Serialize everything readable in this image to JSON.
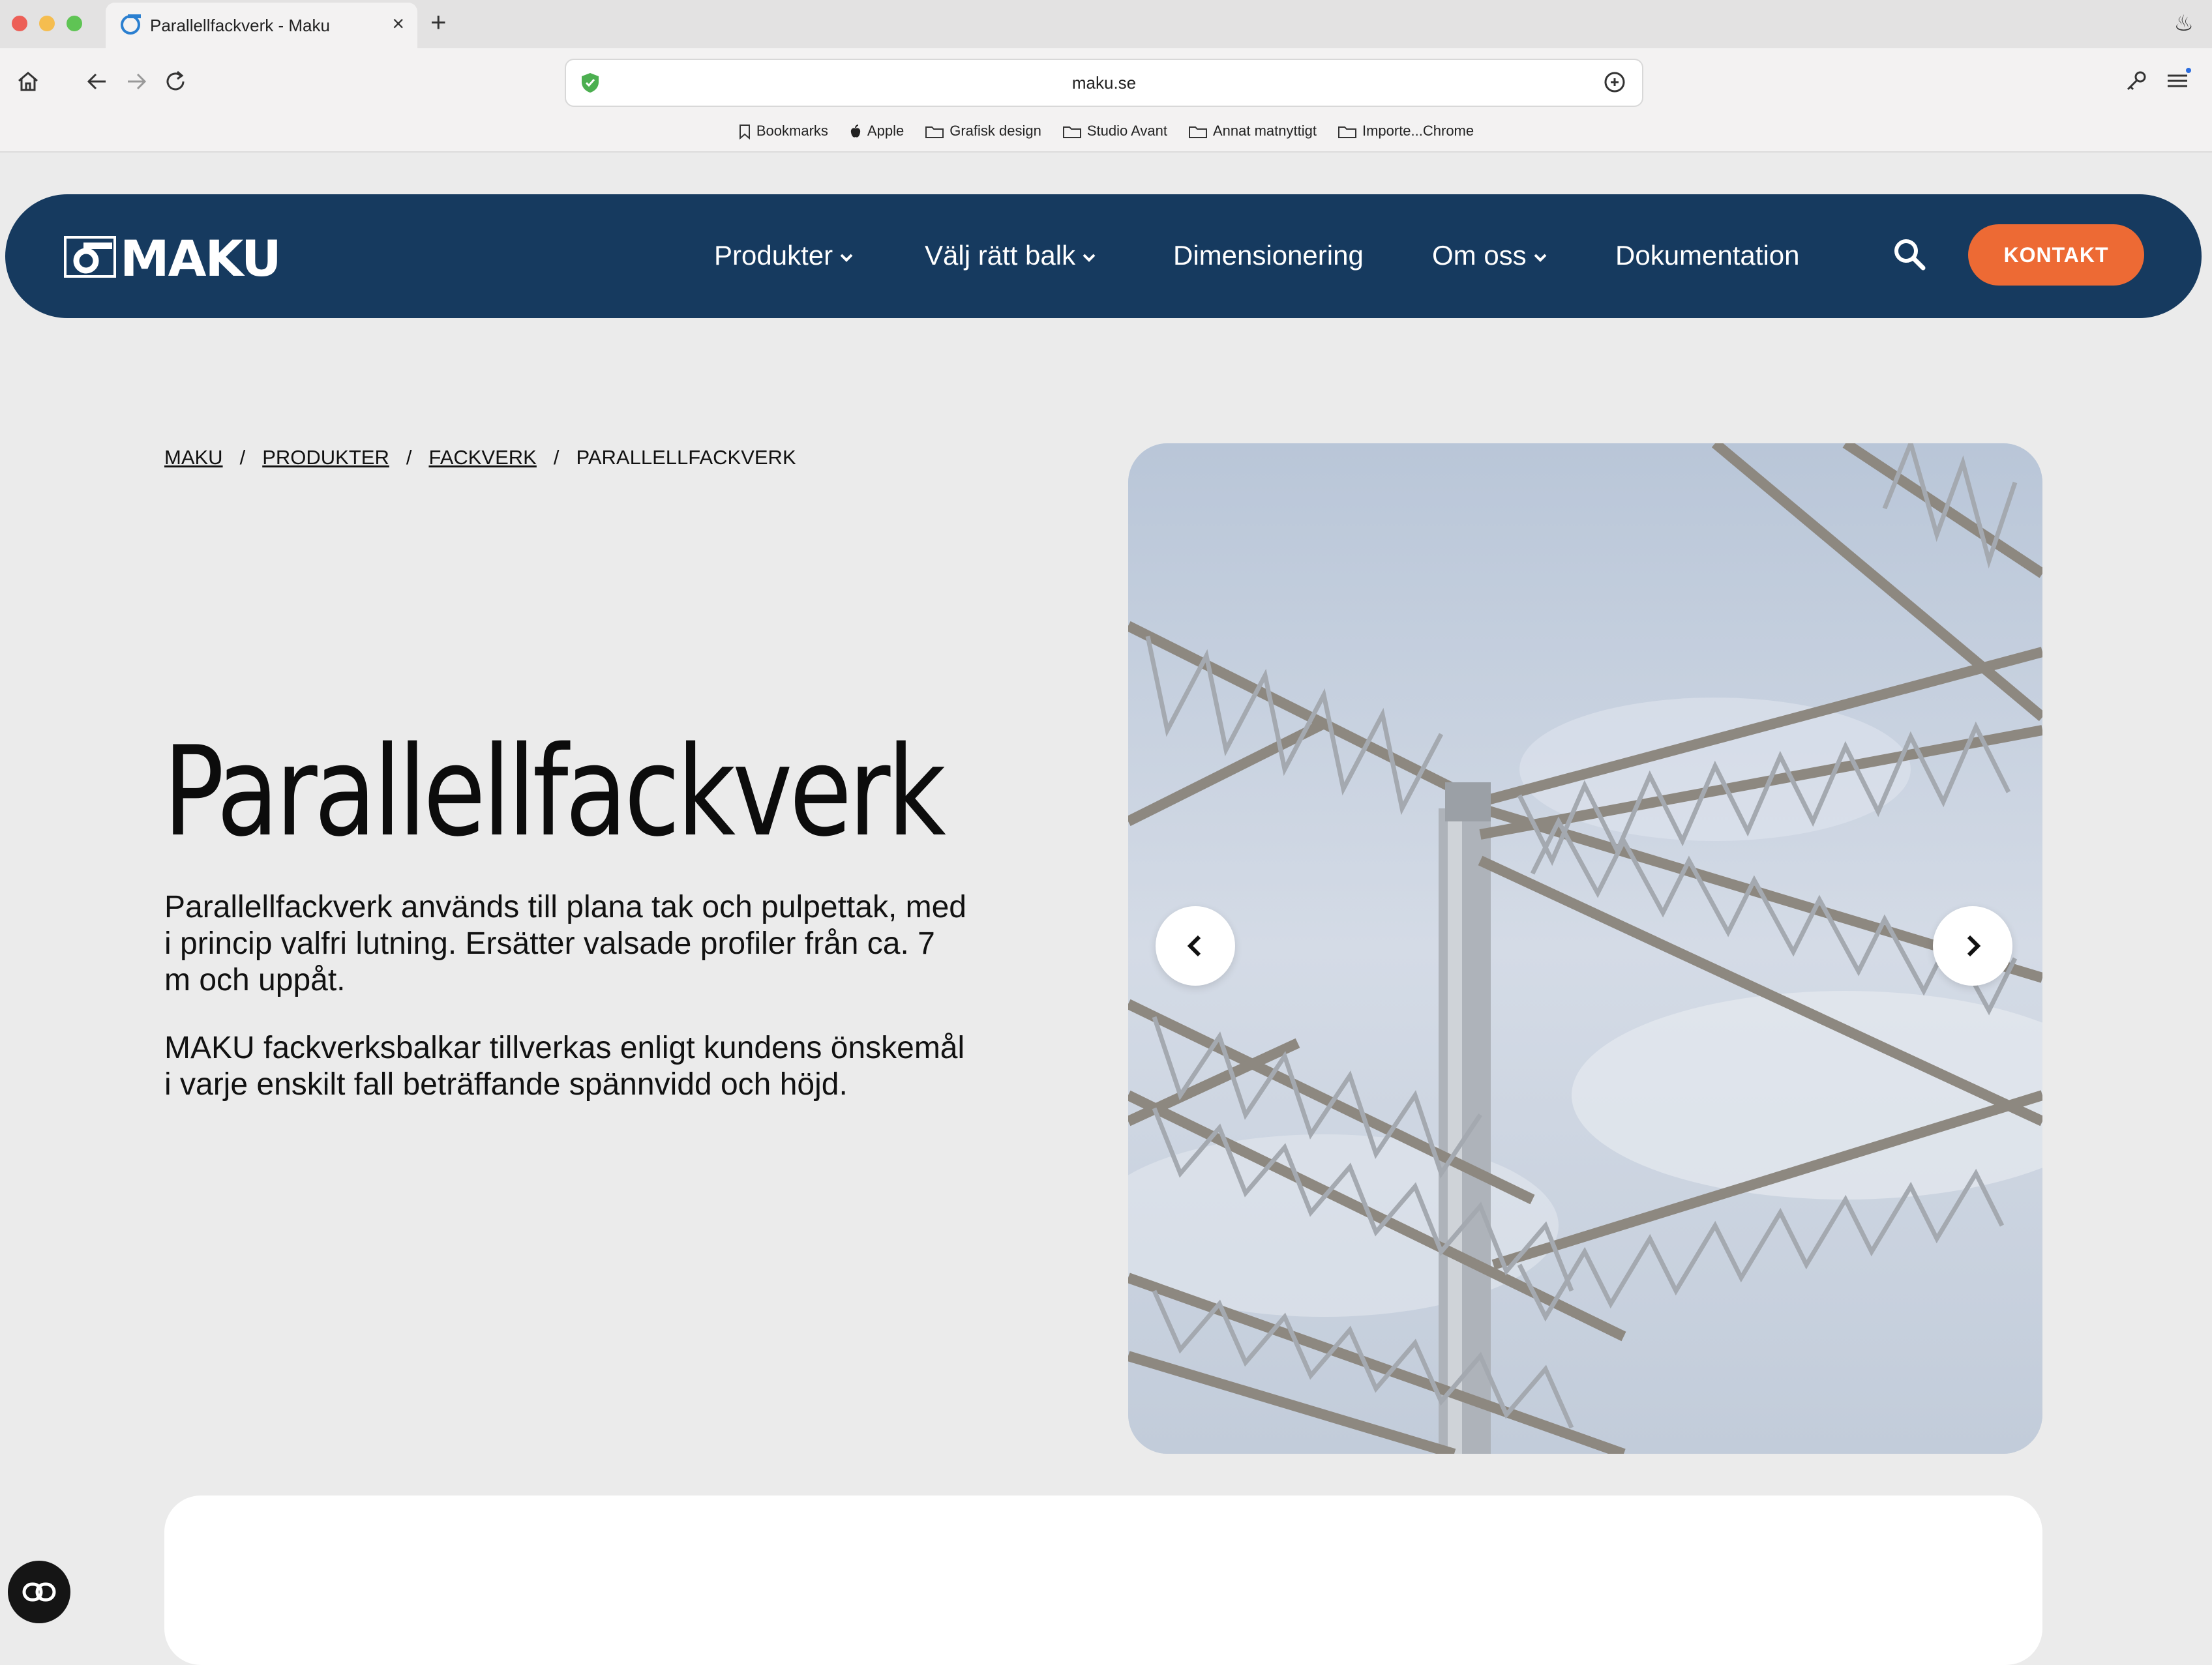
{
  "browser": {
    "tab_title": "Parallellfackverk - Maku",
    "url": "maku.se",
    "bookmarks": [
      "Bookmarks",
      "Apple",
      "Grafisk design",
      "Studio Avant",
      "Annat matnyttigt",
      "Importe...Chrome"
    ]
  },
  "nav": {
    "logo_text": "MAKU",
    "items": [
      "Produkter",
      "Välj rätt balk",
      "Dimensionering",
      "Om oss",
      "Dokumentation"
    ],
    "contact_label": "KONTAKT"
  },
  "breadcrumb": [
    "MAKU",
    "PRODUKTER",
    "FACKVERK",
    "PARALLELLFACKVERK"
  ],
  "main": {
    "title": "Parallellfackverk",
    "paragraphs": [
      "Parallellfackverk används till plana tak och pulpettak, med i princip valfri lutning. Ersätter valsade profiler från ca. 7 m och uppåt.",
      "MAKU fackverksbalkar tillverkas enligt kundens önskemål i varje enskilt fall beträffande spännvidd och höjd."
    ]
  },
  "colors": {
    "nav_bg": "#163a5f",
    "accent": "#ed6a34",
    "page_bg": "#ebebeb"
  }
}
